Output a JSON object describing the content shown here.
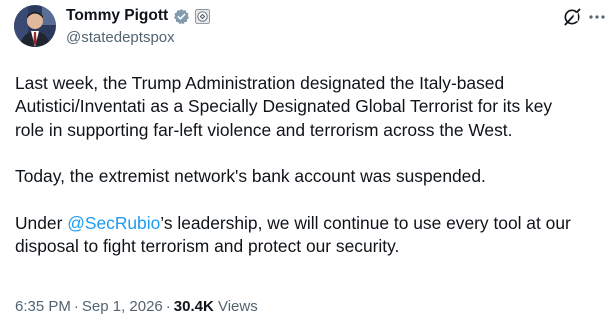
{
  "author": {
    "display_name": "Tommy Pigott",
    "handle": "@statedeptspox",
    "avatar": "avatar",
    "verified_icon": "verified-badge-icon",
    "affiliation_icon": "government-seal-icon"
  },
  "tweet": {
    "para1": "Last week, the Trump Administration designated the Italy-based\nAutistici/Inventati as a Specially Designated Global Terrorist for its key\nrole in supporting far-left violence and terrorism across the West.",
    "para2": "Today, the extremist network's bank account was suspended.",
    "para3_prefix": "Under ",
    "para3_mention": "@SecRubio",
    "para3_suffix": "’s leadership, we will continue to use every tool at our\ndisposal to fight terrorism and protect our security."
  },
  "meta": {
    "time": "6:35 PM",
    "separator1": "·",
    "date": "Sep 1, 2026",
    "separator2": "·",
    "views_count": "30.4K",
    "views_label": "Views"
  },
  "icons": {
    "grok": "grok-icon",
    "more": "more-options-icon"
  },
  "colors": {
    "text": "#0f1419",
    "secondary": "#536471",
    "accent": "#1d9bf0",
    "verified_gray": "#829aab"
  }
}
